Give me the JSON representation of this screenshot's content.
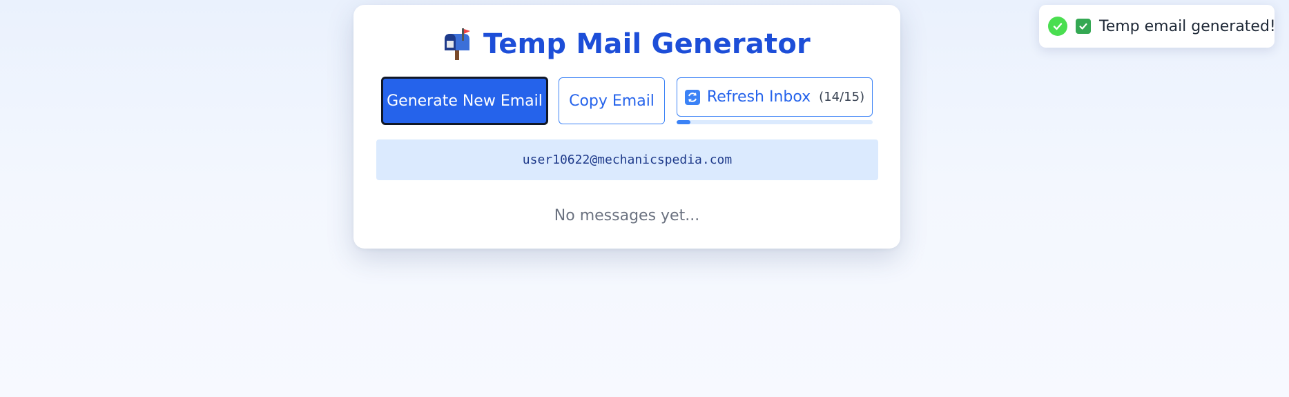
{
  "app": {
    "title": "Temp Mail Generator",
    "title_icon": "mailbox-icon",
    "accent_color": "#1d4ed8"
  },
  "toolbar": {
    "generate_label": "Generate New Email",
    "copy_label": "Copy Email",
    "refresh_label": "Refresh Inbox",
    "refresh_icon": "refresh-icon",
    "refresh_count": "(14/15)",
    "refresh_progress_fraction": 0.07
  },
  "email": {
    "address": "user10622@mechanicspedia.com"
  },
  "inbox": {
    "empty_text": "No messages yet..."
  },
  "toast": {
    "text": "Temp email generated!",
    "icons": [
      "success-check-icon",
      "checkbox-check-icon"
    ],
    "status_color": "#4ade50"
  }
}
